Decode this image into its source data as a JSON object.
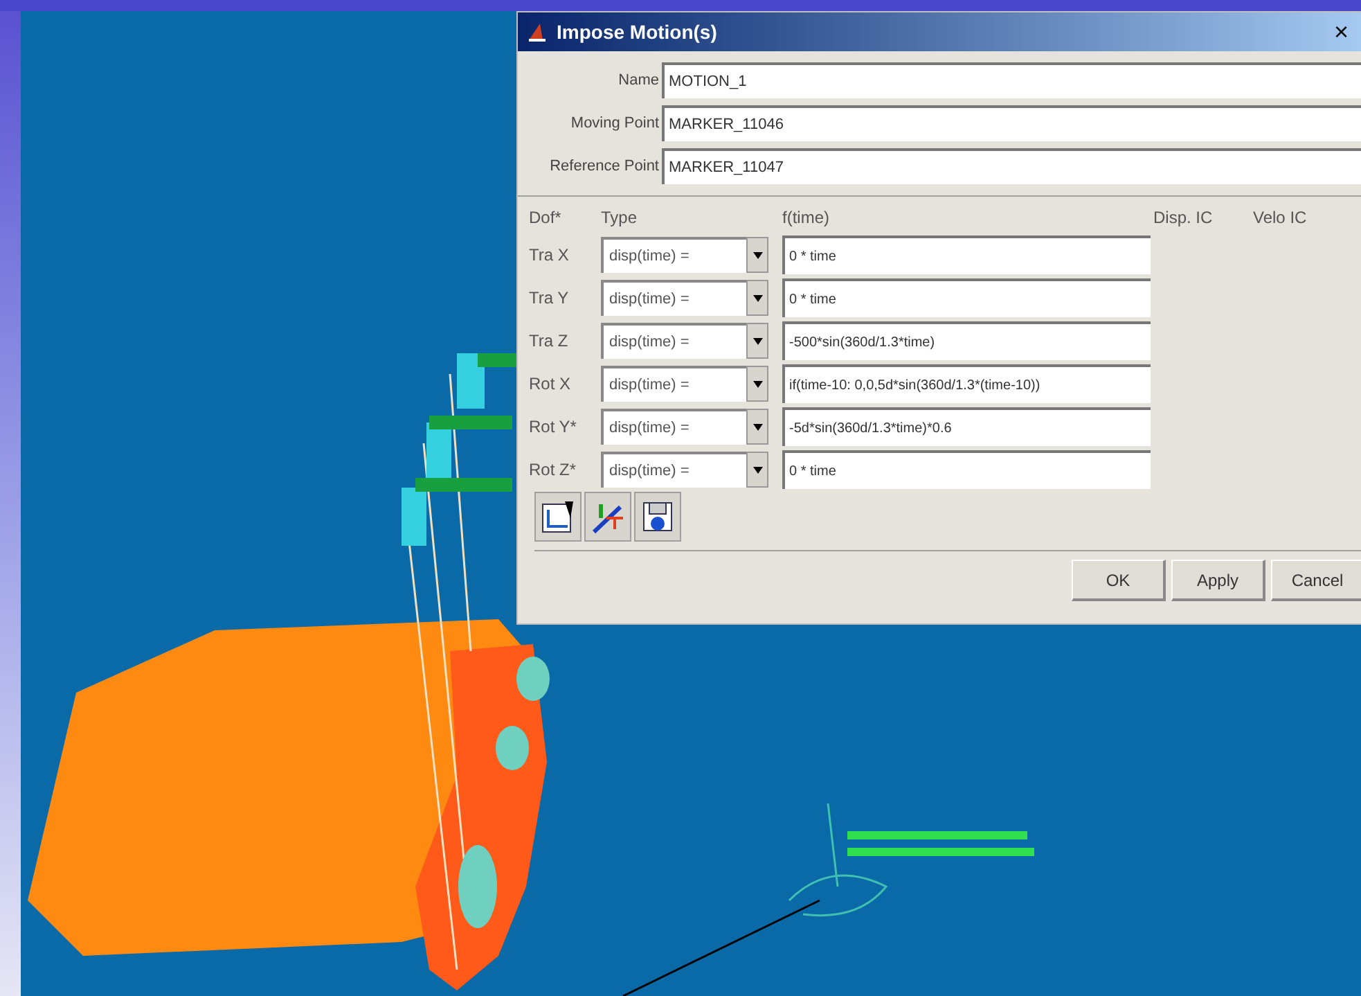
{
  "dialog": {
    "title": "Impose Motion(s)",
    "close": "×",
    "fields": [
      {
        "label": "Name",
        "value": "MOTION_1"
      },
      {
        "label": "Moving Point",
        "value": "MARKER_11046"
      },
      {
        "label": "Reference Point",
        "value": "MARKER_11047"
      }
    ],
    "columns": [
      "Dof*",
      "Type",
      "f(time)",
      "Disp. IC",
      "Velo IC"
    ],
    "rows": [
      {
        "dof": "Tra X",
        "type": "disp(time) =",
        "expression": "0 * time"
      },
      {
        "dof": "Tra Y",
        "type": "disp(time) =",
        "expression": "0 * time"
      },
      {
        "dof": "Tra Z",
        "type": "disp(time) =",
        "expression": "-500*sin(360d/1.3*time)"
      },
      {
        "dof": "Rot X",
        "type": "disp(time) =",
        "expression": "if(time-10: 0,0,5d*sin(360d/1.3*(time-10))"
      },
      {
        "dof": "Rot Y*",
        "type": "disp(time) =",
        "expression": "-5d*sin(360d/1.3*time)*0.6"
      },
      {
        "dof": "Rot Z*",
        "type": "disp(time) =",
        "expression": "0 * time"
      }
    ],
    "buttons": [
      "OK",
      "Apply",
      "Cancel"
    ]
  }
}
